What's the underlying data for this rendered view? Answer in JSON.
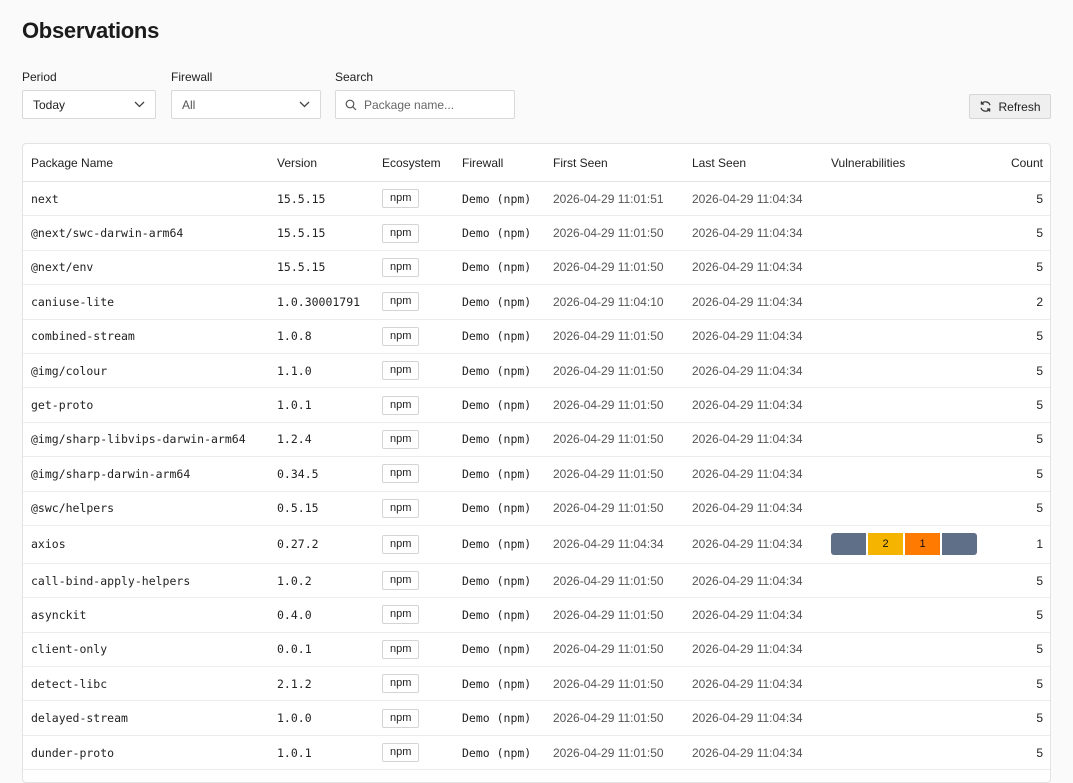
{
  "page": {
    "title": "Observations"
  },
  "filters": {
    "period": {
      "label": "Period",
      "value": "Today"
    },
    "firewall": {
      "label": "Firewall",
      "value": "All"
    },
    "search": {
      "label": "Search",
      "placeholder": "Package name...",
      "value": ""
    }
  },
  "refresh": {
    "label": "Refresh"
  },
  "table": {
    "columns": [
      "Package Name",
      "Version",
      "Ecosystem",
      "Firewall",
      "First Seen",
      "Last Seen",
      "Vulnerabilities",
      "Count"
    ],
    "rows": [
      {
        "name": "next",
        "version": "15.5.15",
        "ecosystem": "npm",
        "firewall": "Demo (npm)",
        "first_seen": "2026-04-29 11:01:51",
        "last_seen": "2026-04-29 11:04:34",
        "vulnerabilities": null,
        "count": "5"
      },
      {
        "name": "@next/swc-darwin-arm64",
        "version": "15.5.15",
        "ecosystem": "npm",
        "firewall": "Demo (npm)",
        "first_seen": "2026-04-29 11:01:50",
        "last_seen": "2026-04-29 11:04:34",
        "vulnerabilities": null,
        "count": "5"
      },
      {
        "name": "@next/env",
        "version": "15.5.15",
        "ecosystem": "npm",
        "firewall": "Demo (npm)",
        "first_seen": "2026-04-29 11:01:50",
        "last_seen": "2026-04-29 11:04:34",
        "vulnerabilities": null,
        "count": "5"
      },
      {
        "name": "caniuse-lite",
        "version": "1.0.30001791",
        "ecosystem": "npm",
        "firewall": "Demo (npm)",
        "first_seen": "2026-04-29 11:04:10",
        "last_seen": "2026-04-29 11:04:34",
        "vulnerabilities": null,
        "count": "2"
      },
      {
        "name": "combined-stream",
        "version": "1.0.8",
        "ecosystem": "npm",
        "firewall": "Demo (npm)",
        "first_seen": "2026-04-29 11:01:50",
        "last_seen": "2026-04-29 11:04:34",
        "vulnerabilities": null,
        "count": "5"
      },
      {
        "name": "@img/colour",
        "version": "1.1.0",
        "ecosystem": "npm",
        "firewall": "Demo (npm)",
        "first_seen": "2026-04-29 11:01:50",
        "last_seen": "2026-04-29 11:04:34",
        "vulnerabilities": null,
        "count": "5"
      },
      {
        "name": "get-proto",
        "version": "1.0.1",
        "ecosystem": "npm",
        "firewall": "Demo (npm)",
        "first_seen": "2026-04-29 11:01:50",
        "last_seen": "2026-04-29 11:04:34",
        "vulnerabilities": null,
        "count": "5"
      },
      {
        "name": "@img/sharp-libvips-darwin-arm64",
        "version": "1.2.4",
        "ecosystem": "npm",
        "firewall": "Demo (npm)",
        "first_seen": "2026-04-29 11:01:50",
        "last_seen": "2026-04-29 11:04:34",
        "vulnerabilities": null,
        "count": "5"
      },
      {
        "name": "@img/sharp-darwin-arm64",
        "version": "0.34.5",
        "ecosystem": "npm",
        "firewall": "Demo (npm)",
        "first_seen": "2026-04-29 11:01:50",
        "last_seen": "2026-04-29 11:04:34",
        "vulnerabilities": null,
        "count": "5"
      },
      {
        "name": "@swc/helpers",
        "version": "0.5.15",
        "ecosystem": "npm",
        "firewall": "Demo (npm)",
        "first_seen": "2026-04-29 11:01:50",
        "last_seen": "2026-04-29 11:04:34",
        "vulnerabilities": null,
        "count": "5"
      },
      {
        "name": "axios",
        "version": "0.27.2",
        "ecosystem": "npm",
        "firewall": "Demo (npm)",
        "first_seen": "2026-04-29 11:04:34",
        "last_seen": "2026-04-29 11:04:34",
        "vulnerabilities": [
          {
            "severity": "critical",
            "count": "",
            "color": "#5f6f87"
          },
          {
            "severity": "high",
            "count": "2",
            "color": "#f5b400"
          },
          {
            "severity": "medium",
            "count": "1",
            "color": "#ff7a00"
          },
          {
            "severity": "low",
            "count": "",
            "color": "#5f6f87"
          }
        ],
        "count": "1"
      },
      {
        "name": "call-bind-apply-helpers",
        "version": "1.0.2",
        "ecosystem": "npm",
        "firewall": "Demo (npm)",
        "first_seen": "2026-04-29 11:01:50",
        "last_seen": "2026-04-29 11:04:34",
        "vulnerabilities": null,
        "count": "5"
      },
      {
        "name": "asynckit",
        "version": "0.4.0",
        "ecosystem": "npm",
        "firewall": "Demo (npm)",
        "first_seen": "2026-04-29 11:01:50",
        "last_seen": "2026-04-29 11:04:34",
        "vulnerabilities": null,
        "count": "5"
      },
      {
        "name": "client-only",
        "version": "0.0.1",
        "ecosystem": "npm",
        "firewall": "Demo (npm)",
        "first_seen": "2026-04-29 11:01:50",
        "last_seen": "2026-04-29 11:04:34",
        "vulnerabilities": null,
        "count": "5"
      },
      {
        "name": "detect-libc",
        "version": "2.1.2",
        "ecosystem": "npm",
        "firewall": "Demo (npm)",
        "first_seen": "2026-04-29 11:01:50",
        "last_seen": "2026-04-29 11:04:34",
        "vulnerabilities": null,
        "count": "5"
      },
      {
        "name": "delayed-stream",
        "version": "1.0.0",
        "ecosystem": "npm",
        "firewall": "Demo (npm)",
        "first_seen": "2026-04-29 11:01:50",
        "last_seen": "2026-04-29 11:04:34",
        "vulnerabilities": null,
        "count": "5"
      },
      {
        "name": "dunder-proto",
        "version": "1.0.1",
        "ecosystem": "npm",
        "firewall": "Demo (npm)",
        "first_seen": "2026-04-29 11:01:50",
        "last_seen": "2026-04-29 11:04:34",
        "vulnerabilities": null,
        "count": "5"
      }
    ]
  },
  "icons": {
    "dropdown": "chevron-down-icon",
    "search": "search-icon",
    "refresh": "refresh-icon"
  }
}
